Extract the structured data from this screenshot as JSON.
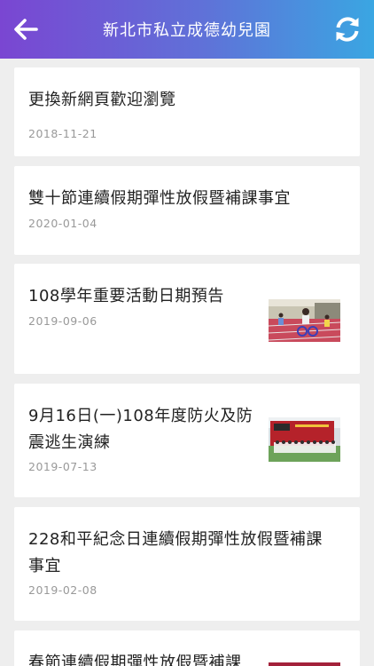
{
  "header": {
    "title": "新北市私立成德幼兒園",
    "back_icon": "arrow-left-icon",
    "refresh_icon": "refresh-icon"
  },
  "colors": {
    "header_gradient_start": "#7a46d2",
    "header_gradient_end": "#3aa6e2",
    "background": "#eeeeee"
  },
  "news": [
    {
      "title": "更換新網頁歡迎瀏覽",
      "date": "2018-11-21"
    },
    {
      "title": "雙十節連續假期彈性放假暨補課事宜",
      "date": "2020-01-04"
    },
    {
      "title": "108學年重要活動日期預告",
      "date": "2019-09-06",
      "thumbnail": "photo of children riding tricycles on a track"
    },
    {
      "title": "9月16日(一)108年度防火及防震逃生演練",
      "date": "2019-07-13",
      "thumbnail": "photo of children in front of a red fire truck"
    },
    {
      "title": "228和平紀念日連續假期彈性放假暨補課事宜",
      "date": "2019-02-08"
    },
    {
      "title": "春節連續假期彈性放假暨補課",
      "date": ""
    }
  ]
}
